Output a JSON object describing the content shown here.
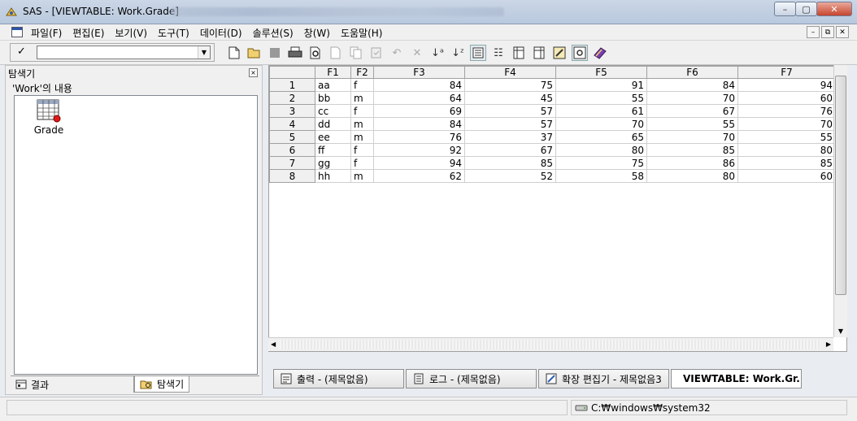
{
  "window": {
    "title": "SAS - [VIEWTABLE: Work.Grade]",
    "minimize": "–",
    "maximize": "▢",
    "close": "✕"
  },
  "menu": {
    "items": [
      "파일(F)",
      "편집(E)",
      "보기(V)",
      "도구(T)",
      "데이터(D)",
      "솔루션(S)",
      "창(W)",
      "도움말(H)"
    ],
    "mdi_min": "–",
    "mdi_restore": "⧉",
    "mdi_close": "✕"
  },
  "toolbar": {
    "command_check": "✓",
    "command_value": "",
    "icons": [
      "new-icon",
      "open-icon",
      "save-icon",
      "print-icon",
      "print-preview-icon",
      "find-icon",
      "copy-icon",
      "paste-icon",
      "undo-icon",
      "delete-icon",
      "sort-ascending-icon",
      "sort-descending-icon",
      "form-view-icon",
      "table-view-icon",
      "column-attributes-icon",
      "add-column-icon",
      "edit-mode-icon",
      "browse-mode-icon",
      "help-book-icon"
    ]
  },
  "explorer": {
    "title": "탐색기",
    "close": "×",
    "content_label": "'Work'의 내용",
    "item_label": "Grade",
    "tab_results": "결과",
    "tab_explorer": "탐색기"
  },
  "table": {
    "columns": [
      "F1",
      "F2",
      "F3",
      "F4",
      "F5",
      "F6",
      "F7"
    ],
    "rows": [
      {
        "n": "1",
        "f1": "aa",
        "f2": "f",
        "f3": "84",
        "f4": "75",
        "f5": "91",
        "f6": "84",
        "f7": "94"
      },
      {
        "n": "2",
        "f1": "bb",
        "f2": "m",
        "f3": "64",
        "f4": "45",
        "f5": "55",
        "f6": "70",
        "f7": "60"
      },
      {
        "n": "3",
        "f1": "cc",
        "f2": "f",
        "f3": "69",
        "f4": "57",
        "f5": "61",
        "f6": "67",
        "f7": "76"
      },
      {
        "n": "4",
        "f1": "dd",
        "f2": "m",
        "f3": "84",
        "f4": "57",
        "f5": "70",
        "f6": "55",
        "f7": "70"
      },
      {
        "n": "5",
        "f1": "ee",
        "f2": "m",
        "f3": "76",
        "f4": "37",
        "f5": "65",
        "f6": "70",
        "f7": "55"
      },
      {
        "n": "6",
        "f1": "ff",
        "f2": "f",
        "f3": "92",
        "f4": "67",
        "f5": "80",
        "f6": "85",
        "f7": "80"
      },
      {
        "n": "7",
        "f1": "gg",
        "f2": "f",
        "f3": "94",
        "f4": "85",
        "f5": "75",
        "f6": "86",
        "f7": "85"
      },
      {
        "n": "8",
        "f1": "hh",
        "f2": "m",
        "f3": "62",
        "f4": "52",
        "f5": "58",
        "f6": "80",
        "f7": "60"
      }
    ]
  },
  "taskbar": {
    "tabs": [
      "출력 - (제목없음)",
      "로그 - (제목없음)",
      "확장 편집기 - 제목없음3",
      "VIEWTABLE: Work.Gr..."
    ]
  },
  "status": {
    "path": "C:₩windows₩system32"
  }
}
